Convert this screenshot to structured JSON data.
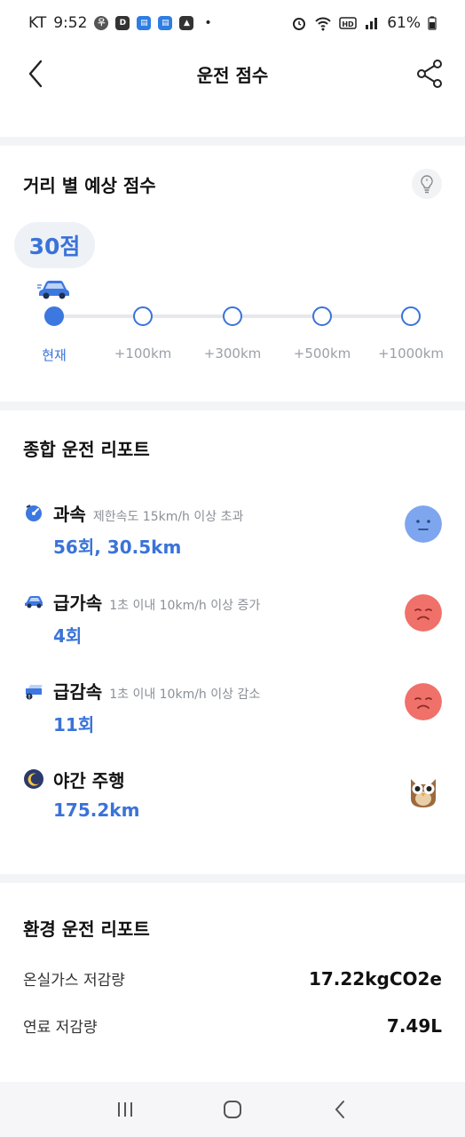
{
  "status_bar": {
    "carrier": "KT",
    "time": "9:52",
    "battery": "61%"
  },
  "header": {
    "title": "운전 점수"
  },
  "distance": {
    "title": "거리 별 예상 점수",
    "score": "30점",
    "nodes": [
      "현재",
      "+100km",
      "+300km",
      "+500km",
      "+1000km"
    ]
  },
  "report": {
    "title": "종합 운전 리포트",
    "items": [
      {
        "title": "과속",
        "desc": "제한속도 15km/h 이상 초과",
        "value": "56회, 30.5km",
        "icon": "speedometer-icon",
        "face": "neutral-face-icon"
      },
      {
        "title": "급가속",
        "desc": "1초 이내 10km/h 이상 증가",
        "value": "4회",
        "icon": "car-icon",
        "face": "sad-face-icon"
      },
      {
        "title": "급감속",
        "desc": "1초 이내 10km/h 이상 감소",
        "value": "11회",
        "icon": "brake-icon",
        "face": "sad-face-icon"
      },
      {
        "title": "야간 주행",
        "desc": "",
        "value": "175.2km",
        "icon": "moon-icon",
        "face": "owl-icon"
      }
    ]
  },
  "eco": {
    "title": "환경 운전 리포트",
    "rows": [
      {
        "label": "온실가스 저감량",
        "value": "17.22kgCO2e"
      },
      {
        "label": "연료 저감량",
        "value": "7.49L"
      }
    ]
  },
  "colors": {
    "accent": "#3a73d8",
    "sad_face": "#f0706a",
    "neutral_face": "#7ea6ee"
  }
}
